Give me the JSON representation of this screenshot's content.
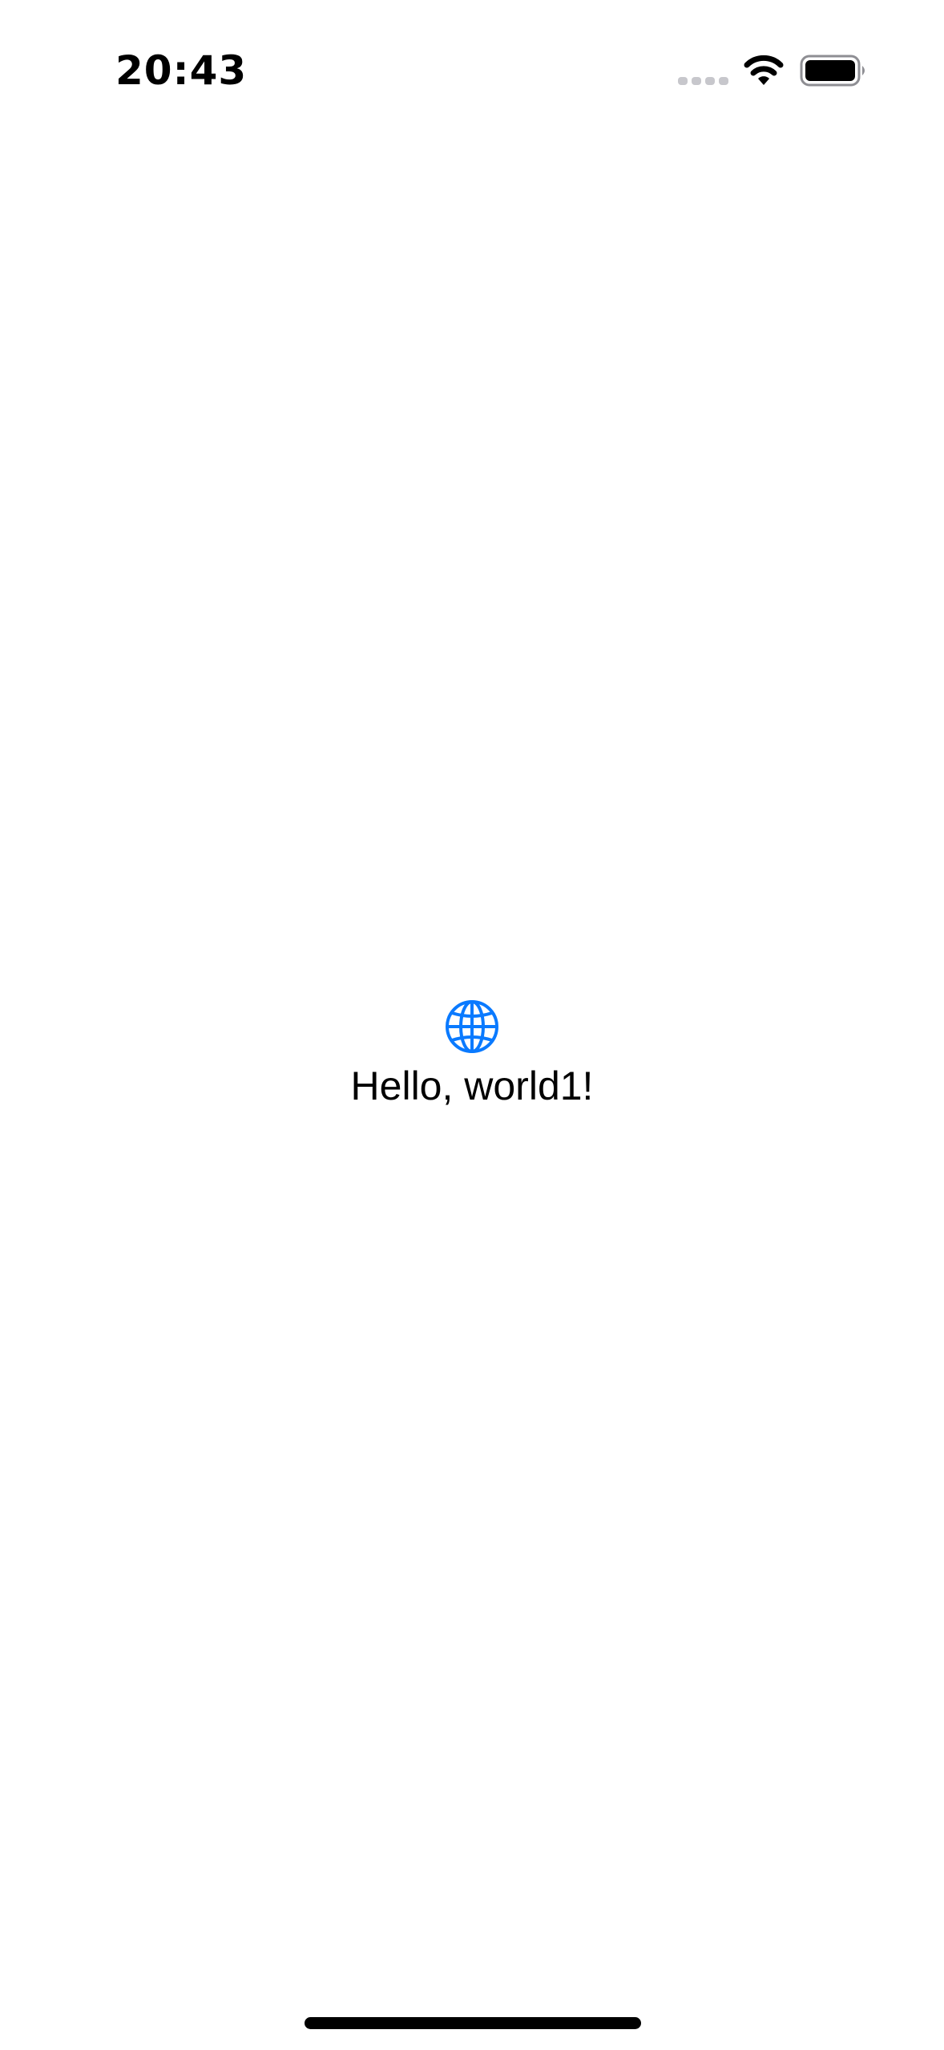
{
  "status_bar": {
    "time": "20:43",
    "icons": [
      "cellular-signal-icon",
      "wifi-icon",
      "battery-icon"
    ]
  },
  "main": {
    "icon": "globe-icon",
    "icon_color": "#0A7AFF",
    "greeting": "Hello, world1!"
  }
}
